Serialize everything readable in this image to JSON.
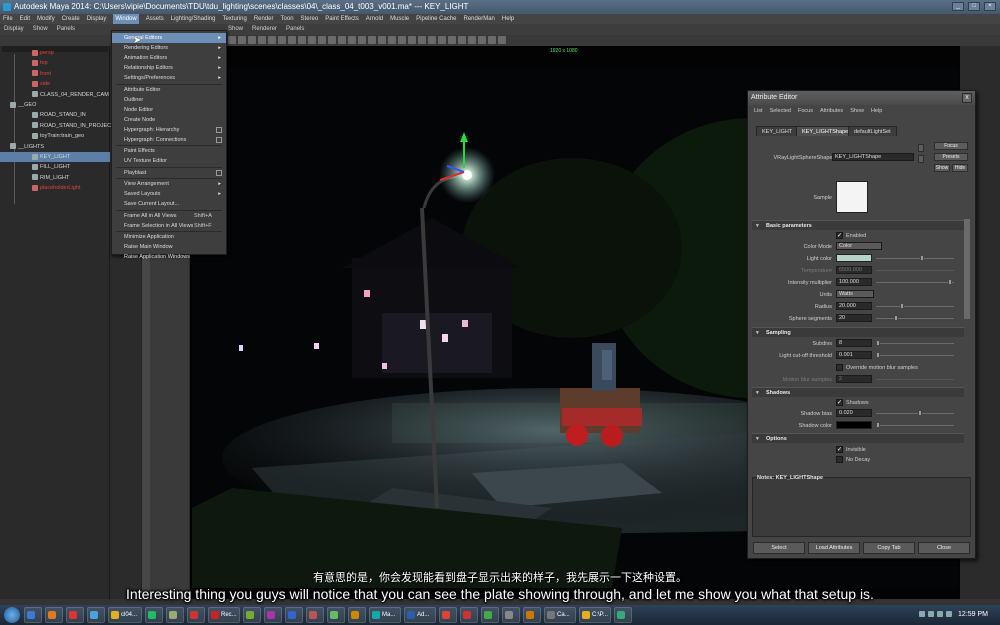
{
  "window": {
    "title": "Autodesk Maya 2014: C:\\Users\\vipie\\Documents\\TDU\\tdu_lighting\\scenes\\classes\\04\\_class_04_t003_v001.ma*   ---   KEY_LIGHT"
  },
  "menubar": [
    "File",
    "Edit",
    "Modify",
    "Create",
    "Display",
    "Window",
    "Assets",
    "Lighting/Shading",
    "Texturing",
    "Render",
    "Toon",
    "Stereo",
    "Paint Effects",
    "Arnold",
    "Muscle",
    "Pipeline Cache",
    "RenderMan",
    "Help"
  ],
  "menubar_active": "Window",
  "outliner_menu": [
    "Display",
    "Show",
    "Panels"
  ],
  "viewport_menu": [
    "Show",
    "Renderer",
    "Panels"
  ],
  "outliner": {
    "items": [
      {
        "label": "persp",
        "color": "red",
        "indent": 1
      },
      {
        "label": "top",
        "color": "red",
        "indent": 1
      },
      {
        "label": "front",
        "color": "red",
        "indent": 1
      },
      {
        "label": "side",
        "color": "red",
        "indent": 1
      },
      {
        "label": "CLASS_04_RENDER_CAM",
        "color": "plain",
        "indent": 1
      },
      {
        "label": "__GEO",
        "color": "plain",
        "indent": 0
      },
      {
        "label": "ROAD_STAND_IN",
        "color": "plain",
        "indent": 1
      },
      {
        "label": "ROAD_STAND_IN_PROJECT",
        "color": "plain",
        "indent": 1
      },
      {
        "label": "toyTrain:train_geo",
        "color": "plain",
        "indent": 1
      },
      {
        "label": "__LIGHTS",
        "color": "plain",
        "indent": 0
      },
      {
        "label": "KEY_LIGHT",
        "color": "plain",
        "indent": 1,
        "selected": true
      },
      {
        "label": "FILL_LIGHT",
        "color": "plain",
        "indent": 1
      },
      {
        "label": "RIM_LIGHT",
        "color": "plain",
        "indent": 1
      },
      {
        "label": "placeholderLight",
        "color": "red",
        "indent": 1
      }
    ]
  },
  "window_menu": {
    "items": [
      {
        "label": "General Editors",
        "submenu": true,
        "highlight": true
      },
      {
        "label": "Rendering Editors",
        "submenu": true
      },
      {
        "label": "Animation Editors",
        "submenu": true
      },
      {
        "label": "Relationship Editors",
        "submenu": true
      },
      {
        "label": "Settings/Preferences",
        "submenu": true
      },
      {
        "label": "Attribute Editor",
        "sep_before": true
      },
      {
        "label": "Outliner"
      },
      {
        "label": "Node Editor"
      },
      {
        "label": "Create Node"
      },
      {
        "label": "Hypergraph: Hierarchy",
        "option": true
      },
      {
        "label": "Hypergraph: Connections",
        "option": true
      },
      {
        "label": "Paint Effects",
        "sep_before": true
      },
      {
        "label": "UV Texture Editor"
      },
      {
        "label": "Playblast",
        "option": true,
        "sep_before": true
      },
      {
        "label": "View Arrangement",
        "submenu": true,
        "sep_before": true
      },
      {
        "label": "Saved Layouts",
        "submenu": true
      },
      {
        "label": "Save Current Layout..."
      },
      {
        "label": "Frame All in All Views",
        "shortcut": "Shift+A",
        "sep_before": true
      },
      {
        "label": "Frame Selection in All Views",
        "shortcut": "Shift+F"
      },
      {
        "label": "Minimize Application",
        "sep_before": true
      },
      {
        "label": "Raise Main Window"
      },
      {
        "label": "Raise Application Windows"
      }
    ]
  },
  "viewport": {
    "camera_label": "1920 x 1080"
  },
  "attribute_editor": {
    "title": "Attribute Editor",
    "close": "x",
    "menu": [
      "List",
      "Selected",
      "Focus",
      "Attributes",
      "Show",
      "Help"
    ],
    "tabs": [
      "KEY_LIGHT",
      "KEY_LIGHTShape",
      "defaultLightSet"
    ],
    "active_tab": "KEY_LIGHTShape",
    "node_type_label": "VRayLightSphereShape:",
    "node_name": "KEY_LIGHTShape",
    "buttons": {
      "focus": "Focus",
      "presets": "Presets",
      "show": "Show",
      "hide": "Hide"
    },
    "sample_label": "Sample",
    "sections": {
      "basic": "Basic parameters",
      "sampling": "Sampling",
      "shadows": "Shadows",
      "options": "Options"
    },
    "basic": {
      "enabled": "Enabled",
      "color_mode_label": "Color Mode",
      "color_mode_value": "Color",
      "light_color_label": "Light color",
      "light_color_hex": "#b7d2c8",
      "temperature_label": "Temperature",
      "temperature_value": "6500.000",
      "intensity_label": "Intensity multiplier",
      "intensity_value": "100.000",
      "units_label": "Units",
      "units_value": "Watts",
      "radius_label": "Radius",
      "radius_value": "20.000",
      "segments_label": "Sphere segments",
      "segments_value": "20"
    },
    "sampling": {
      "subdivs_label": "Subdivs",
      "subdivs_value": "8",
      "cutoff_label": "Light cut-off threshold",
      "cutoff_value": "0.001",
      "override_label": "Override motion blur samples",
      "mb_label": "Motion blur samples",
      "mb_value": "2"
    },
    "shadows": {
      "shadows_label": "Shadows",
      "bias_label": "Shadow bias",
      "bias_value": "0.020",
      "color_label": "Shadow color"
    },
    "options": {
      "invisible": "Invisible",
      "no_decay": "No Decay"
    },
    "notes_label": "Notes:  KEY_LIGHTShape",
    "bottom_buttons": [
      "Select",
      "Load Attributes",
      "Copy Tab",
      "Close"
    ]
  },
  "subtitles": {
    "zh": "有意思的是，你会发现能看到盘子显示出来的样子，我先展示一下这种设置。",
    "en": "Interesting thing you guys will notice that you can see the plate showing through, and let me show you what that setup is."
  },
  "taskbar": {
    "tasks": [
      {
        "label": "",
        "color": "#3a7bd5",
        "w": 18
      },
      {
        "label": "",
        "color": "#e07a1f",
        "w": 18
      },
      {
        "label": "",
        "color": "#d33",
        "w": 18
      },
      {
        "label": "",
        "color": "#4aa3df",
        "w": 18
      },
      {
        "label": "cl04...",
        "color": "#e0b020",
        "w": 34
      },
      {
        "label": "",
        "color": "#2b6",
        "w": 18
      },
      {
        "label": "",
        "color": "#9a7",
        "w": 18
      },
      {
        "label": "",
        "color": "#c33",
        "w": 18
      },
      {
        "label": "Rec...",
        "color": "#c22",
        "w": 32
      },
      {
        "label": "",
        "color": "#7a3",
        "w": 18
      },
      {
        "label": "",
        "color": "#a3a",
        "w": 18
      },
      {
        "label": "",
        "color": "#36c",
        "w": 18
      },
      {
        "label": "",
        "color": "#b55",
        "w": 18
      },
      {
        "label": "",
        "color": "#6b6",
        "w": 18
      },
      {
        "label": "",
        "color": "#c80",
        "w": 18
      },
      {
        "label": "Ma...",
        "color": "#1aa",
        "w": 32
      },
      {
        "label": "Ad...",
        "color": "#2b5da8",
        "w": 32
      },
      {
        "label": "",
        "color": "#d43",
        "w": 18
      },
      {
        "label": "",
        "color": "#c33",
        "w": 18
      },
      {
        "label": "",
        "color": "#4a4",
        "w": 18
      },
      {
        "label": "",
        "color": "#888",
        "w": 18
      },
      {
        "label": "",
        "color": "#c70",
        "w": 18
      },
      {
        "label": "Ca...",
        "color": "#777",
        "w": 32
      },
      {
        "label": "C:\\P...",
        "color": "#e0b020",
        "w": 32
      },
      {
        "label": "",
        "color": "#3a7",
        "w": 18
      }
    ],
    "clock": "12:59 PM"
  }
}
